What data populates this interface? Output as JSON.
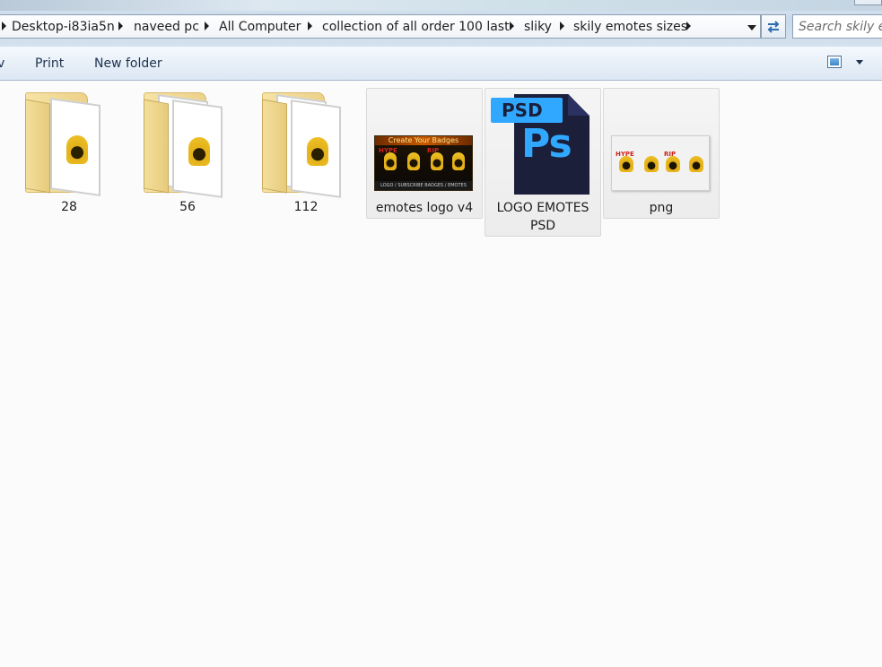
{
  "window": {
    "breadcrumb": [
      "Desktop-i83ia5n",
      "naveed pc",
      "All Computer",
      "collection of all order 100 last",
      "sliky",
      "skily emotes sizes"
    ],
    "search_placeholder": "Search skily em"
  },
  "toolbar": {
    "partial_left": "v",
    "print_label": "Print",
    "new_folder_label": "New folder"
  },
  "files": [
    {
      "name": "28",
      "type": "folder"
    },
    {
      "name": "56",
      "type": "folder"
    },
    {
      "name": "112",
      "type": "folder"
    },
    {
      "name": "emotes logo v4",
      "type": "image",
      "thumb_banner": "Create Your Badges",
      "thumb_footer": "LOGO / SUBSCRIBE BADGES / EMOTES",
      "thumb_tags": [
        "HYPE",
        "RIP"
      ]
    },
    {
      "name_line1": "LOGO EMOTES",
      "name_line2": "PSD",
      "type": "psd",
      "icon_tag": "PSD",
      "icon_text": "Ps"
    },
    {
      "name": "png",
      "type": "image",
      "thumb_tags": [
        "HYPE",
        "RIP"
      ]
    }
  ],
  "colors": {
    "accent": "#31a8ff",
    "psd_dark": "#1b1f3a",
    "folder": "#f3df9b"
  }
}
